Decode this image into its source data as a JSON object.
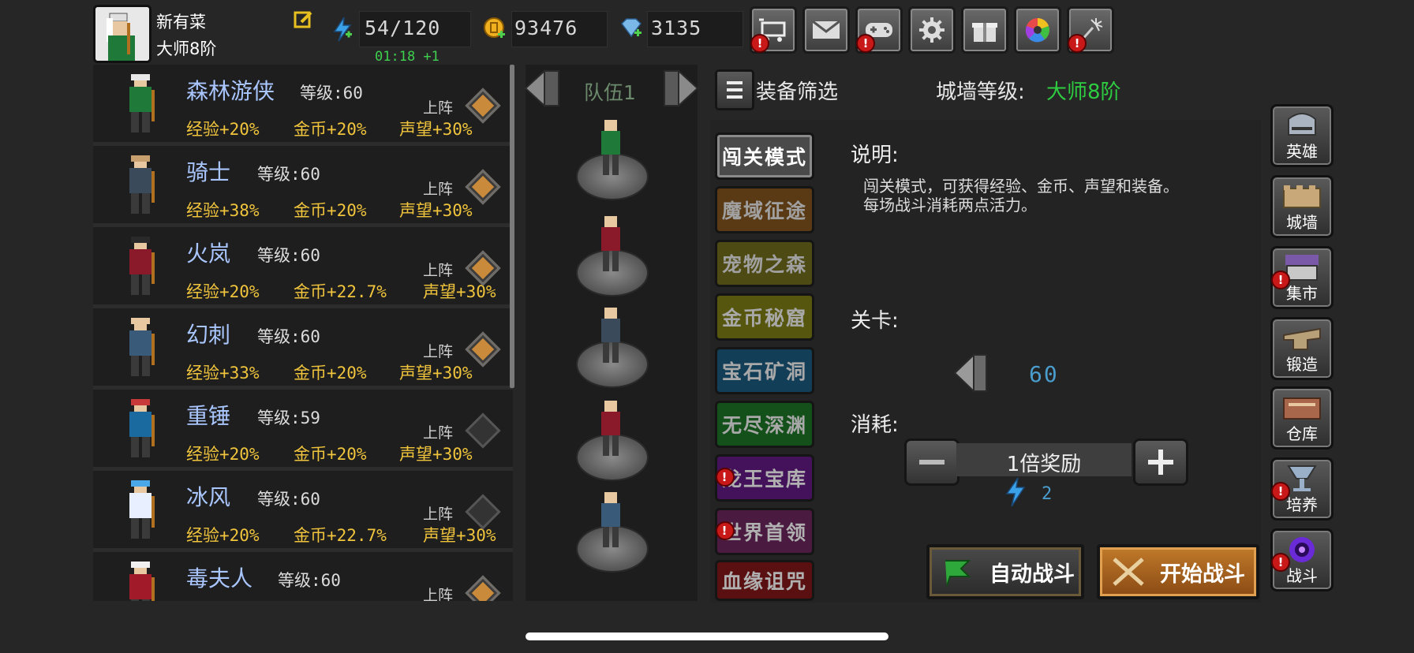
{
  "player": {
    "name": "新有菜",
    "rank": "大师8阶",
    "energy": "54/120",
    "energy_timer": "01:18 +1",
    "gold": "93476",
    "gems": "3135"
  },
  "top_icons": [
    {
      "name": "shop-cart-icon",
      "badge": true
    },
    {
      "name": "mail-icon",
      "badge": false
    },
    {
      "name": "gamepad-icon",
      "badge": true
    },
    {
      "name": "settings-gear-icon",
      "badge": false
    },
    {
      "name": "gift-icon",
      "badge": false
    },
    {
      "name": "color-wheel-icon",
      "badge": false
    },
    {
      "name": "fireworks-icon",
      "badge": true
    }
  ],
  "heroes": [
    {
      "name": "森林游侠",
      "level_label": "等级:60",
      "exp": "经验+20%",
      "gold": "金币+20%",
      "fame": "声望+30%",
      "deploy": "上阵",
      "active": true
    },
    {
      "name": "骑士",
      "level_label": "等级:60",
      "exp": "经验+38%",
      "gold": "金币+20%",
      "fame": "声望+30%",
      "deploy": "上阵",
      "active": true
    },
    {
      "name": "火岚",
      "level_label": "等级:60",
      "exp": "经验+20%",
      "gold": "金币+22.7%",
      "fame": "声望+30%",
      "deploy": "上阵",
      "active": true
    },
    {
      "name": "幻刺",
      "level_label": "等级:60",
      "exp": "经验+33%",
      "gold": "金币+20%",
      "fame": "声望+30%",
      "deploy": "上阵",
      "active": true
    },
    {
      "name": "重锤",
      "level_label": "等级:59",
      "exp": "经验+20%",
      "gold": "金币+20%",
      "fame": "声望+30%",
      "deploy": "上阵",
      "active": false
    },
    {
      "name": "冰风",
      "level_label": "等级:60",
      "exp": "经验+20%",
      "gold": "金币+22.7%",
      "fame": "声望+30%",
      "deploy": "上阵",
      "active": false
    },
    {
      "name": "毒夫人",
      "level_label": "等级:60",
      "exp": "",
      "gold": "",
      "fame": "",
      "deploy": "上阵",
      "active": true
    }
  ],
  "team": {
    "label": "队伍1"
  },
  "filter": {
    "label": "装备筛选",
    "wall_label": "城墙等级:",
    "wall_value": "大师8阶"
  },
  "modes": [
    {
      "label": "闯关模式",
      "bg": "#4a4a4a",
      "fg": "#ffffff",
      "badge": false,
      "selected": true
    },
    {
      "label": "魔域征途",
      "bg": "#5a3a14",
      "fg": "#a0a0a0",
      "badge": false
    },
    {
      "label": "宠物之森",
      "bg": "#4e4a14",
      "fg": "#a0a0a0",
      "badge": false
    },
    {
      "label": "金币秘窟",
      "bg": "#56560e",
      "fg": "#a8a8a8",
      "badge": false
    },
    {
      "label": "宝石矿洞",
      "bg": "#123e58",
      "fg": "#a8a8a8",
      "badge": false
    },
    {
      "label": "无尽深渊",
      "bg": "#14501a",
      "fg": "#a8a8a8",
      "badge": false
    },
    {
      "label": "龙王宝库",
      "bg": "#44125a",
      "fg": "#b0b0b0",
      "badge": true
    },
    {
      "label": "世界首领",
      "bg": "#4a1a40",
      "fg": "#b0b0b0",
      "badge": true
    },
    {
      "label": "血缘诅咒",
      "bg": "#5a1010",
      "fg": "#b0b0b0",
      "badge": false
    }
  ],
  "detail": {
    "desc_title": "说明:",
    "desc_line1": "闯关模式，可获得经验、金币、声望和装备。",
    "desc_line2": "每场战斗消耗两点活力。",
    "stage_title": "关卡:",
    "stage_value": "60",
    "cost_title": "消耗:",
    "multiplier": "1倍奖励",
    "energy_cost": "2"
  },
  "actions": {
    "auto": "自动战斗",
    "start": "开始战斗"
  },
  "side_menu": [
    {
      "label": "英雄",
      "icon": "helmet-icon",
      "badge": false
    },
    {
      "label": "城墙",
      "icon": "castle-wall-icon",
      "badge": false
    },
    {
      "label": "集市",
      "icon": "market-icon",
      "badge": true
    },
    {
      "label": "锻造",
      "icon": "anvil-icon",
      "badge": false
    },
    {
      "label": "仓库",
      "icon": "warehouse-icon",
      "badge": false
    },
    {
      "label": "培养",
      "icon": "chalice-icon",
      "badge": true
    },
    {
      "label": "战斗",
      "icon": "portal-icon",
      "badge": true
    }
  ],
  "colors": {
    "gold_text": "#f0c43c",
    "hero_name": "#a9c6ff",
    "wall_value": "#2ecc40",
    "stage_value": "#4a9ccc"
  }
}
